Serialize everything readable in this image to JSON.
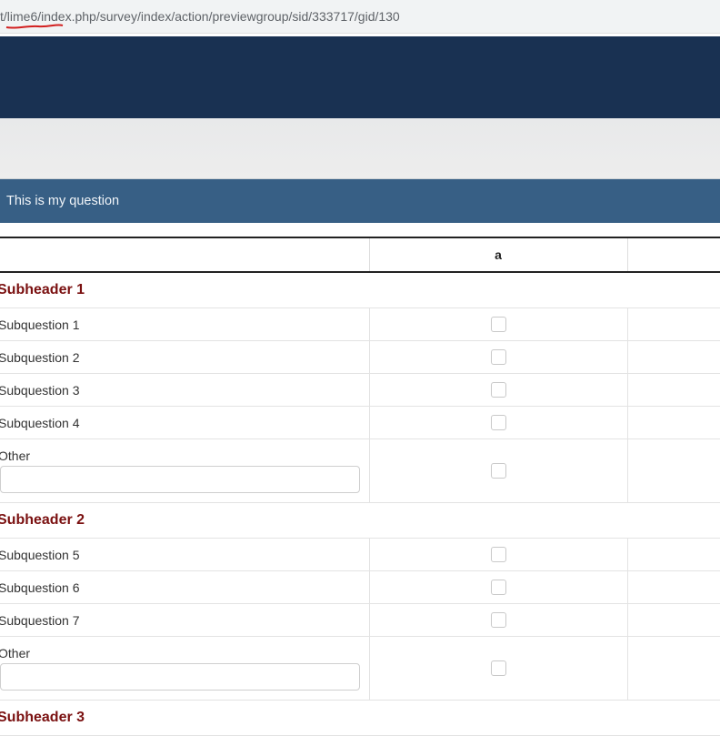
{
  "browser": {
    "url": "t/lime6/index.php/survey/index/action/previewgroup/sid/333717/gid/130",
    "annotation_color": "#d21f1f"
  },
  "colors": {
    "nav_bg": "#193152",
    "question_bg": "#375f85",
    "subheader_text": "#7a1010"
  },
  "question": {
    "title": "This is my question"
  },
  "table": {
    "columns": [
      "",
      "a",
      ""
    ],
    "subheader1": "Subheader 1",
    "subheader2": "Subheader 2",
    "subheader3": "Subheader 3",
    "rows": {
      "sq1": "Subquestion 1",
      "sq2": "Subquestion 2",
      "sq3": "Subquestion 3",
      "sq4": "Subquestion 4",
      "other1": "Other",
      "sq5": "Subquestion 5",
      "sq6": "Subquestion 6",
      "sq7": "Subquestion 7",
      "other2": "Other"
    }
  }
}
